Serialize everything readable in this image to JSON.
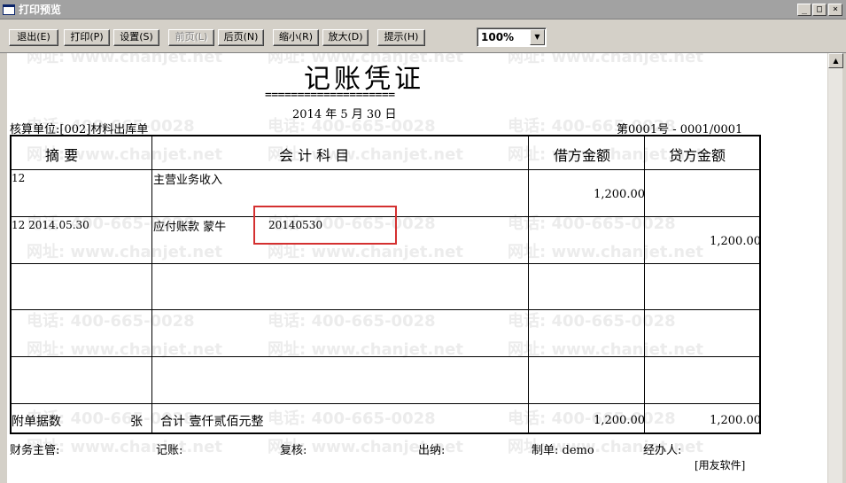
{
  "window": {
    "title": "打印预览",
    "min_label": "_",
    "max_label": "□",
    "close_label": "×"
  },
  "toolbar": {
    "exit": "退出(E)",
    "print": "打印(P)",
    "settings": "设置(S)",
    "prev_page": "前页(L)",
    "next_page": "后页(N)",
    "zoom_out": "缩小(R)",
    "zoom_in": "放大(D)",
    "hint": "提示(H)",
    "zoom_value": "100%"
  },
  "watermark": {
    "phone": "电话: 400-665-0028",
    "url": "网址: www.chanjet.net"
  },
  "voucher": {
    "title": "记账凭证",
    "title_rule": "====================",
    "date": "2014 年  5  月 30 日",
    "unit": "核算单位:[002]材料出库单",
    "number": "第0001号 - 0001/0001",
    "headers": {
      "summary": "摘    要",
      "account": "会  计  科  目",
      "debit": "借方金额",
      "credit": "贷方金额"
    },
    "rows": [
      {
        "summary": "12",
        "account": "主营业务收入",
        "detail": "",
        "debit": "1,200.00",
        "credit": ""
      },
      {
        "summary": "12  2014.05.30",
        "account": "应付账款   蒙牛",
        "detail": "20140530",
        "debit": "",
        "credit": "1,200.00"
      },
      {
        "summary": "",
        "account": "",
        "detail": "",
        "debit": "",
        "credit": ""
      },
      {
        "summary": "",
        "account": "",
        "detail": "",
        "debit": "",
        "credit": ""
      },
      {
        "summary": "",
        "account": "",
        "detail": "",
        "debit": "",
        "credit": ""
      }
    ],
    "footer": {
      "attachments_label": "附单据数",
      "attachments_unit": "张",
      "total_label": "合计 壹仟贰佰元整",
      "total_debit": "1,200.00",
      "total_credit": "1,200.00"
    },
    "signatures": {
      "supervisor": "财务主管:",
      "bookkeeper": "记账:",
      "reviewer": "复核:",
      "cashier": "出纳:",
      "preparer": "制单: demo",
      "handler": "经办人:"
    },
    "software": "[用友软件]"
  },
  "colors": {
    "highlight": "#d43030",
    "title_bar": "#a2a2a2"
  }
}
